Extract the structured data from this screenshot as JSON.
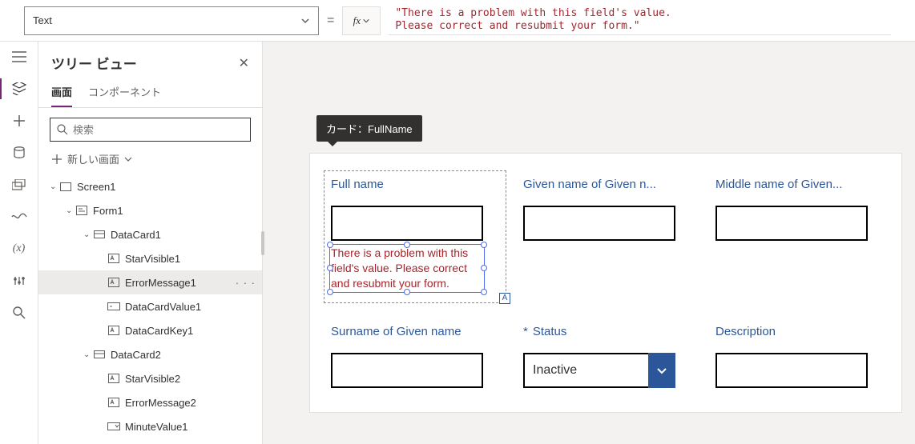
{
  "formula_bar": {
    "property": "Text",
    "fx_label": "fx",
    "value": "\"There is a problem with this field's value.\nPlease correct and resubmit your form.\""
  },
  "tree": {
    "title": "ツリー ビュー",
    "tabs": {
      "screens": "画面",
      "components": "コンポーネント"
    },
    "search_placeholder": "検索",
    "new_screen": "新しい画面",
    "nodes": {
      "screen1": "Screen1",
      "form1": "Form1",
      "datacard1": "DataCard1",
      "starvisible1": "StarVisible1",
      "errormessage1": "ErrorMessage1",
      "datacardvalue1": "DataCardValue1",
      "datacardkey1": "DataCardKey1",
      "datacard2": "DataCard2",
      "starvisible2": "StarVisible2",
      "errormessage2": "ErrorMessage2",
      "minutevalue1": "MinuteValue1"
    }
  },
  "canvas": {
    "tooltip": "カード：FullName",
    "cards": {
      "fullname": {
        "label": "Full name",
        "error": "There is a problem with this field's value.  Please correct and resubmit your form."
      },
      "givenname": {
        "label": "Given name of Given n..."
      },
      "middlename": {
        "label": "Middle name of Given..."
      },
      "surname": {
        "label": "Surname of Given name"
      },
      "status": {
        "label": "Status",
        "required": "*",
        "value": "Inactive"
      },
      "description": {
        "label": "Description"
      }
    },
    "aa": "A"
  }
}
